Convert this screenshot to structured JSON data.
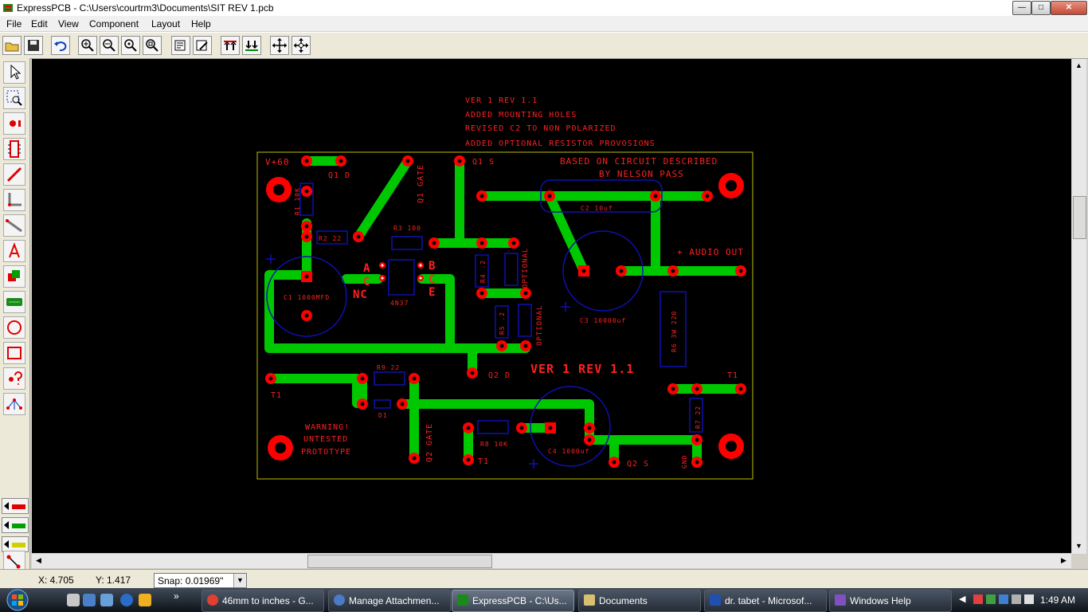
{
  "window": {
    "title": "ExpressPCB - C:\\Users\\courtrm3\\Documents\\SIT REV 1.pcb",
    "min_glyph": "—",
    "max_glyph": "□",
    "close_glyph": "✕"
  },
  "menu": [
    "File",
    "Edit",
    "View",
    "Component",
    "Layout",
    "Help"
  ],
  "toolbar_icons": [
    "open-folder-icon",
    "save-icon",
    "undo-icon",
    "zoom-in-icon",
    "zoom-out-icon",
    "zoom-fit-icon",
    "zoom-window-icon",
    "properties-icon",
    "edit-properties-icon",
    "layer-up-icon",
    "layer-down-icon",
    "move-icon",
    "center-icon"
  ],
  "palette_icons": [
    "pointer-icon",
    "zoom-select-icon",
    "place-pad-icon",
    "place-component-icon",
    "trace-icon",
    "bend-trace-icon",
    "diagonal-trace-icon",
    "text-icon",
    "filled-plane-icon",
    "polygon-plane-icon",
    "circle-icon",
    "board-outline-icon",
    "query-icon",
    "net-connect-icon",
    "layer-top-icon",
    "layer-bottom-icon",
    "layer-silk-icon",
    "connect-icon"
  ],
  "board": {
    "notes": [
      "VER 1 REV 1.1",
      "ADDED MOUNTING HOLES",
      "REVISED C2 TO NON POLARIZED",
      "ADDED OPTIONAL RESISTOR PROVOSIONS"
    ],
    "credit_line1": "BASED ON CIRCUIT DESCRIBED",
    "credit_line2": "BY NELSON PASS",
    "labels": {
      "vplus": "V+60",
      "q1d": "Q1 D",
      "q1gate": "Q1 GATE",
      "q1s": "Q1 S",
      "r1": "R1 10K",
      "r2": "R2 22",
      "r3": "R3 100",
      "r4": "R4 .2",
      "r5": "R5 .2",
      "opt1": "OPTIONAL",
      "opt2": "OPTIONAL",
      "c2": "C2 10uf",
      "audio": "+ AUDIO OUT",
      "c1": "C1 1000MFD",
      "c3": "C3 10000uf",
      "u1": "4N37",
      "pinA": "A",
      "pinC": "C",
      "pinNC": "NC",
      "pinB": "B",
      "pinC2": "C",
      "pinE": "E",
      "r6": "R6 3W 220",
      "ver": "VER 1 REV 1.1",
      "q2d": "Q2 D",
      "t1a": "T1",
      "t1b": "T1",
      "t1c": "T1",
      "r9": "R9 22",
      "d1": "D1",
      "q2gate": "Q2 GATE",
      "r8": "R8 10K",
      "c4": "C4 1000uf",
      "q2s": "Q2 S",
      "gnd": "GND",
      "r7": "R7 22",
      "warn1": "WARNING!",
      "warn2": "UNTESTED",
      "warn3": "PROTOTYPE"
    }
  },
  "status": {
    "x": "X: 4.705",
    "y": "Y: 1.417",
    "snap_label": "Snap:",
    "snap_value": "0.01969\""
  },
  "taskbar": {
    "tasks": [
      {
        "label": "46mm to inches - G...",
        "icon": "chrome-icon"
      },
      {
        "label": "Manage Attachmen...",
        "icon": "browser-icon"
      },
      {
        "label": "ExpressPCB - C:\\Us...",
        "icon": "expresspcb-icon"
      },
      {
        "label": "Documents",
        "icon": "folder-icon"
      },
      {
        "label": "dr. tabet - Microsof...",
        "icon": "word-icon"
      },
      {
        "label": "Windows Help",
        "icon": "help-icon"
      }
    ],
    "overflow": "»",
    "clock": "1:49 AM"
  },
  "colors": {
    "trace": "#00c800",
    "pad": "#ff0000",
    "silk": "#ff2020",
    "outline": "#1010b0",
    "board_edge": "#c0c000",
    "canvas": "#000000"
  }
}
